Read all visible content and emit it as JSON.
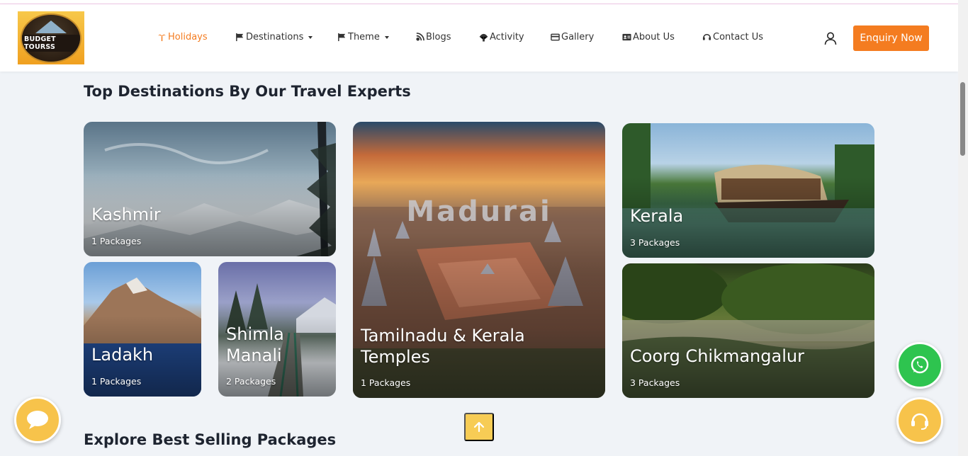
{
  "header": {
    "logo_text": "BUDGET TOURSS",
    "nav": [
      {
        "label": "Holidays",
        "icon": "palm-tree-icon",
        "active": true,
        "dropdown": false
      },
      {
        "label": "Destinations",
        "icon": "flag-icon",
        "active": false,
        "dropdown": true
      },
      {
        "label": "Theme",
        "icon": "flag-icon",
        "active": false,
        "dropdown": true
      },
      {
        "label": "Blogs",
        "icon": "blog-icon",
        "active": false,
        "dropdown": false
      },
      {
        "label": "Activity",
        "icon": "parachute-icon",
        "active": false,
        "dropdown": false
      },
      {
        "label": "Gallery",
        "icon": "card-icon",
        "active": false,
        "dropdown": false
      },
      {
        "label": "About Us",
        "icon": "id-card-icon",
        "active": false,
        "dropdown": false
      },
      {
        "label": "Contact Us",
        "icon": "headset-icon",
        "active": false,
        "dropdown": false
      }
    ],
    "user_icon": "user-icon",
    "enquiry_label": "Enquiry Now"
  },
  "section1": {
    "title": "Top Destinations By Our Travel Experts",
    "cards": [
      {
        "name": "Kashmir",
        "packages": "1 Packages"
      },
      {
        "name": "Ladakh",
        "packages": "1 Packages"
      },
      {
        "name_line1": "Shimla",
        "name_line2": "Manali",
        "packages": "2 Packages"
      },
      {
        "name_line1": "Tamilnadu & Kerala",
        "name_line2": "Temples",
        "packages": "1 Packages",
        "watermark": "Madurai"
      },
      {
        "name": "Kerala",
        "packages": "3 Packages"
      },
      {
        "name": "Coorg Chikmangalur",
        "packages": "3 Packages"
      }
    ]
  },
  "section2": {
    "title": "Explore Best Selling Packages"
  },
  "floating": {
    "chat_icon": "chat-bubble-icon",
    "whatsapp_icon": "whatsapp-icon",
    "support_icon": "headset-icon",
    "scroll_top_icon": "arrow-up-icon"
  },
  "colors": {
    "accent": "#f47c20",
    "whatsapp": "#2ec44f",
    "yellow": "#f7c34b"
  }
}
